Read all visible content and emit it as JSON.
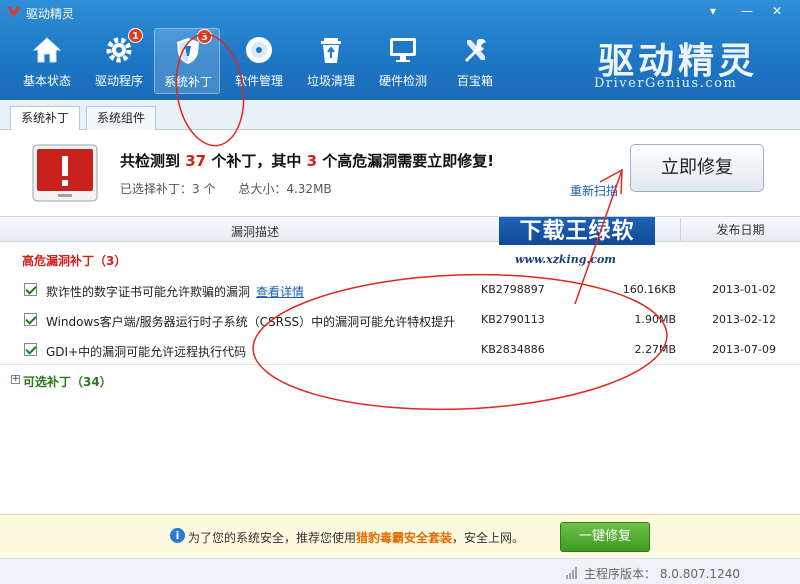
{
  "window": {
    "title": "驱动精灵"
  },
  "nav": [
    {
      "label": "基本状态",
      "icon": "home-icon"
    },
    {
      "label": "驱动程序",
      "icon": "gear-icon",
      "badge": "1"
    },
    {
      "label": "系统补丁",
      "icon": "shield-icon",
      "badge": "3",
      "active": true
    },
    {
      "label": "软件管理",
      "icon": "disc-icon"
    },
    {
      "label": "垃圾清理",
      "icon": "recycle-bin-icon"
    },
    {
      "label": "硬件检测",
      "icon": "monitor-icon"
    },
    {
      "label": "百宝箱",
      "icon": "tools-icon"
    }
  ],
  "brand": {
    "cn": "驱动精灵",
    "en": "DriverGenius.com"
  },
  "tabs": [
    {
      "label": "系统补丁",
      "active": true
    },
    {
      "label": "系统组件"
    }
  ],
  "summary": {
    "prefix": "共检测到",
    "total": "37",
    "mid": "个补丁，其中",
    "critical": "3",
    "suffix": "个高危漏洞需要立即修复!",
    "selected_label": "已选择补丁：3 个",
    "size_label": "总大小：4.32MB",
    "rescan": "重新扫描",
    "fix_now": "立即修复"
  },
  "table": {
    "col_desc": "漏洞描述",
    "col_date": "发布日期"
  },
  "watermark": {
    "top": "下载王绿软",
    "bottom": "www.xzking.com"
  },
  "critical_group": {
    "label": "高危漏洞补丁（3）"
  },
  "rows": [
    {
      "desc": "欺诈性的数字证书可能允许欺骗的漏洞",
      "link": "查看详情",
      "kb": "KB2798897",
      "size": "160.16KB",
      "date": "2013-01-02"
    },
    {
      "desc": "Windows客户端/服务器运行时子系统（CSRSS）中的漏洞可能允许特权提升",
      "kb": "KB2790113",
      "size": "1.90MB",
      "date": "2013-02-12"
    },
    {
      "desc": "GDI+中的漏洞可能允许远程执行代码",
      "kb": "KB2834886",
      "size": "2.27MB",
      "date": "2013-07-09"
    }
  ],
  "optional_group": {
    "expander": "+",
    "label": "可选补丁（34）"
  },
  "bottom": {
    "pre": "为了您的系统安全，推荐您使用",
    "product": "猎豹毒霸安全套装",
    "post": "，安全上网。",
    "button": "一键修复"
  },
  "status": {
    "version": "主程序版本： 8.0.807.1240"
  },
  "colors": {
    "header": "#1f78c6",
    "accent_red": "#d3201b",
    "annotation": "#e0281f",
    "button_green": "#3e9a1f"
  }
}
